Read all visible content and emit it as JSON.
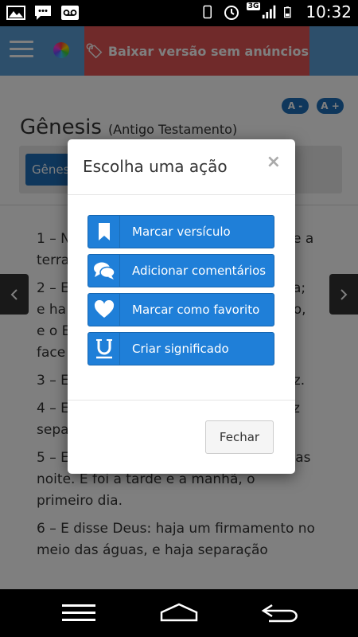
{
  "status_bar": {
    "time": "10:32",
    "network": "3G",
    "icons": [
      "image-icon",
      "chat-icon",
      "voicemail-icon",
      "phone-icon",
      "alarm-icon",
      "signal-icon",
      "battery-icon"
    ]
  },
  "topbar": {
    "ad_banner": "Baixar versão sem anúncios"
  },
  "font_controls": {
    "decrease": "A -",
    "increase": "A +"
  },
  "book": {
    "title": "Gênesis",
    "subtitle": "(Antigo Testamento)",
    "chapter_button": "Gênes"
  },
  "verses": [
    "1 – N",
    "e a",
    "terra",
    "2 – E",
    "a;",
    "e ha",
    "no,",
    "e o E",
    "face",
    "3 – E",
    "uz.",
    "4 – E",
    "z",
    "separ",
    "5 – E Deus chamou à luz dia, e às trevas noite. E foi a tarde e a manhã, o primeiro dia.",
    "6 – E disse Deus: haja um firmamento no meio das águas, e haja separação"
  ],
  "modal": {
    "title": "Escolha uma ação",
    "close_symbol": "×",
    "actions": [
      {
        "label": "Marcar versículo",
        "icon": "bookmark-icon"
      },
      {
        "label": "Adicionar comentários",
        "icon": "comments-icon"
      },
      {
        "label": "Marcar como favorito",
        "icon": "heart-icon"
      },
      {
        "label": "Criar significado",
        "icon": "underline-icon"
      }
    ],
    "close_button": "Fechar"
  },
  "colors": {
    "topbar": "#5b9fd6",
    "ad_banner": "#e05555",
    "action_button": "#1f7fd8",
    "font_button": "#1e6fb8"
  }
}
